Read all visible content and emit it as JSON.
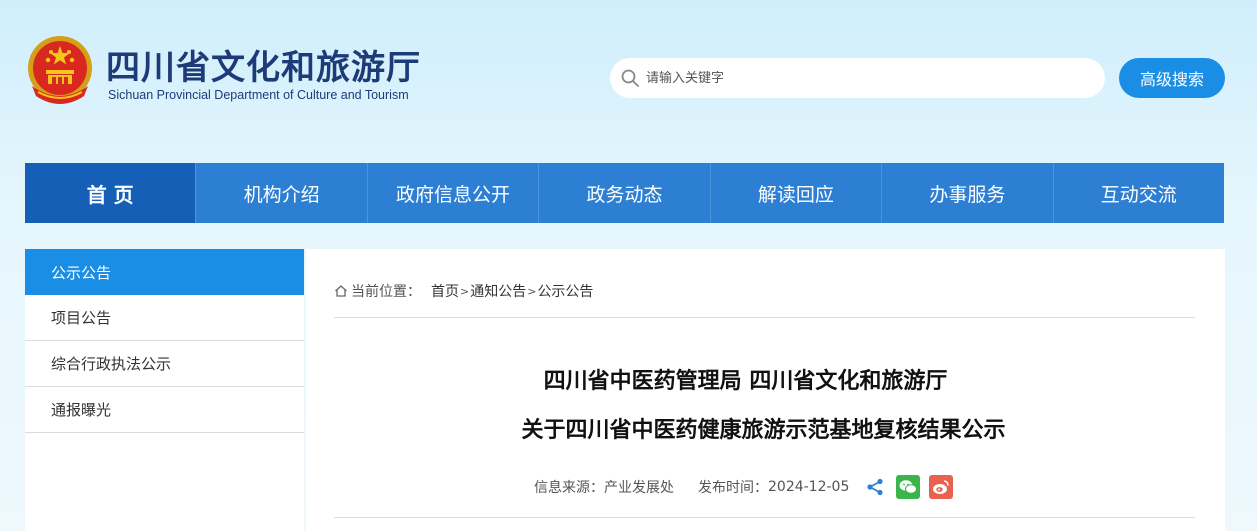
{
  "header": {
    "title": "四川省文化和旅游厅",
    "subtitle": "Sichuan Provincial Department of Culture and Tourism",
    "search_placeholder": "请输入关键字",
    "advanced_search_label": "高级搜索"
  },
  "nav": {
    "items": [
      {
        "label": "首 页",
        "active": true
      },
      {
        "label": "机构介绍"
      },
      {
        "label": "政府信息公开"
      },
      {
        "label": "政务动态"
      },
      {
        "label": "解读回应"
      },
      {
        "label": "办事服务"
      },
      {
        "label": "互动交流"
      }
    ]
  },
  "sidebar": {
    "items": [
      {
        "label": "公示公告",
        "active": true
      },
      {
        "label": "项目公告"
      },
      {
        "label": "综合行政执法公示"
      },
      {
        "label": "通报曝光"
      }
    ]
  },
  "breadcrumb": {
    "prefix": "当前位置：",
    "items": [
      "首页",
      "通知公告",
      "公示公告"
    ],
    "separator": ">"
  },
  "article": {
    "title_line1": "四川省中医药管理局 四川省文化和旅游厅",
    "title_line2": "关于四川省中医药健康旅游示范基地复核结果公示",
    "source_label": "信息来源：",
    "source": "产业发展处",
    "date_label": "发布时间：",
    "date": "2024-12-05"
  },
  "share": {
    "icons": [
      "share-icon",
      "wechat-icon",
      "weibo-icon"
    ]
  },
  "colors": {
    "nav_bg": "#2d7fd4",
    "nav_active": "#1560b6",
    "accent": "#1a8ee4",
    "title_blue": "#1d3b78"
  }
}
